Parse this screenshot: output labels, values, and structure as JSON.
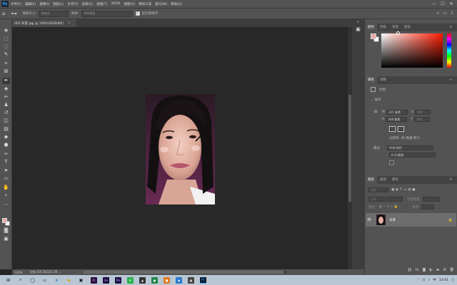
{
  "app": {
    "logo": "Ps"
  },
  "menu": [
    "文件(F)",
    "编辑(E)",
    "图像(I)",
    "图层(L)",
    "文字(Y)",
    "选择(S)",
    "滤镜(T)",
    "3D(D)",
    "视图(V)",
    "增效工具",
    "窗口(W)",
    "帮助(H)"
  ],
  "window_controls": {
    "minimize": "—",
    "maximize": "☐",
    "close": "✕"
  },
  "options": {
    "sample_size_label": "取样大小:",
    "sample_size_value": "取样点",
    "sample_label": "样本:",
    "sample_value": "所有图层",
    "show_ring_label": "显示取样环",
    "show_ring_checked": "✓"
  },
  "document": {
    "tab_title": "003 背景.jpg @ 100%(RGB/8#)",
    "tab_close": "×"
  },
  "status": {
    "zoom": "100%",
    "doc_size": "文档:225.3K/225.3K",
    "arrow": "›"
  },
  "panels": {
    "color_tabs": [
      "颜色",
      "色板",
      "渐变",
      "图案"
    ],
    "props_tabs": [
      "属性",
      "调整"
    ],
    "props_doc": "文档",
    "props_section": "画布",
    "width_label": "W",
    "width_value": "225 像素",
    "height_label": "H",
    "height_value": "348 像素",
    "x_label": "X",
    "x_value": "像素",
    "y_label": "Y",
    "y_value": "像素",
    "resolution": "分辨率: 96 像素/英寸",
    "mode_label": "模式",
    "mode_value": "RGB 颜色",
    "depth_value": "8 位/通道",
    "layers_tabs": [
      "图层",
      "通道",
      "路径"
    ],
    "kind_filter": "类型",
    "blend_mode": "正常",
    "opacity_label": "不透明度:",
    "lock_label": "锁定:",
    "fill_label": "填充:",
    "layer_name": "背景",
    "layer_lock": "🔒"
  },
  "taskbar": {
    "clock": "13:41"
  },
  "colors": {
    "foreground": "#e9a8a8",
    "background": "#ffffff",
    "accent": "#31a8ff"
  }
}
